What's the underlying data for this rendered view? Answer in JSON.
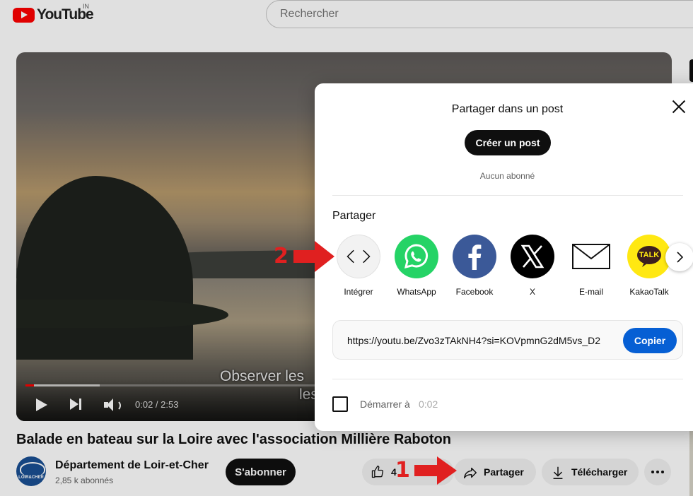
{
  "header": {
    "logo_text": "YouTube",
    "country_code": "IN",
    "search_placeholder": "Rechercher"
  },
  "player": {
    "caption_line1": "Observer les",
    "caption_line2": "les",
    "current_time": "0:02",
    "duration": "2:53",
    "time_display": "0:02 / 2:53",
    "progress_fraction": 0.012
  },
  "video": {
    "title": "Balade en bateau sur la Loire avec l'association Millière Raboton"
  },
  "channel": {
    "avatar_text": "LOIR&CHER",
    "name": "Département de Loir-et-Cher",
    "subscribers": "2,85 k abonnés",
    "subscribe_label": "S'abonner"
  },
  "actions": {
    "like_count": "4",
    "share_label": "Partager",
    "download_label": "Télécharger"
  },
  "share_dialog": {
    "post_title": "Partager dans un post",
    "create_post_label": "Créer un post",
    "no_subscribers": "Aucun abonné",
    "share_heading": "Partager",
    "targets": [
      {
        "label": "Intégrer",
        "icon": "embed-code-icon"
      },
      {
        "label": "WhatsApp",
        "icon": "whatsapp-icon"
      },
      {
        "label": "Facebook",
        "icon": "facebook-icon"
      },
      {
        "label": "X",
        "icon": "x-icon"
      },
      {
        "label": "E-mail",
        "icon": "email-icon"
      },
      {
        "label": "KakaoTalk",
        "icon": "kakaotalk-icon"
      }
    ],
    "kakao_badge": "TALK",
    "url": "https://youtu.be/Zvo3zTAkNH4?si=KOVpmnG2dM5vs_D2",
    "copy_label": "Copier",
    "start_at_label": "Démarrer à",
    "start_at_time": "0:02"
  },
  "annotations": {
    "step1": "1",
    "step2": "2"
  },
  "colors": {
    "youtube_red": "#ff0000",
    "copy_blue": "#065fd4",
    "annotation_red": "#e02020"
  }
}
